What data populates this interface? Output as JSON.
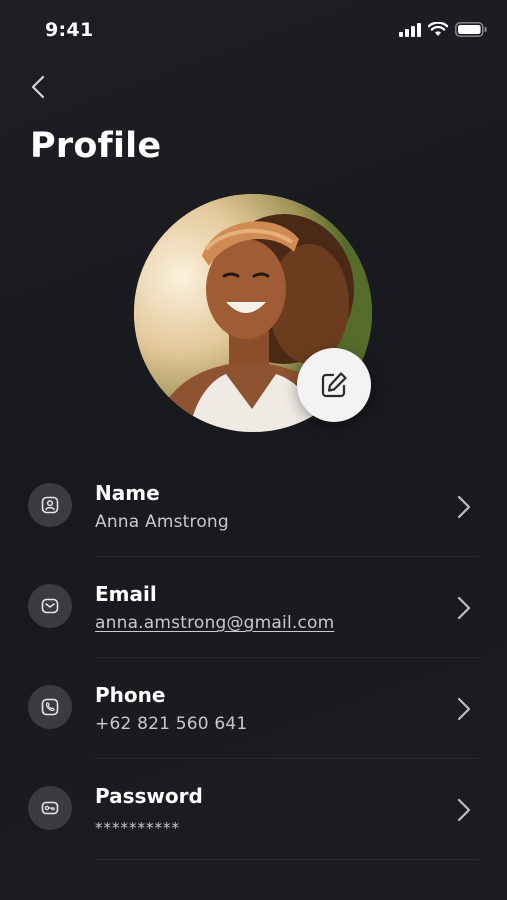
{
  "status_bar": {
    "time": "9:41"
  },
  "header": {
    "title": "Profile"
  },
  "profile": {
    "fields": [
      {
        "label": "Name",
        "value": "Anna Amstrong",
        "icon": "user-icon"
      },
      {
        "label": "Email",
        "value": "anna.amstrong@gmail.com",
        "icon": "mail-icon"
      },
      {
        "label": "Phone",
        "value": "+62 821 560 641",
        "icon": "phone-icon"
      },
      {
        "label": "Password",
        "value": "**********",
        "icon": "key-icon"
      }
    ]
  },
  "colors": {
    "background": "#1b1c21",
    "icon_bg": "#3b3c42",
    "edit_button_bg": "#f3f3f3",
    "secondary_text": "#c9c9cc"
  }
}
